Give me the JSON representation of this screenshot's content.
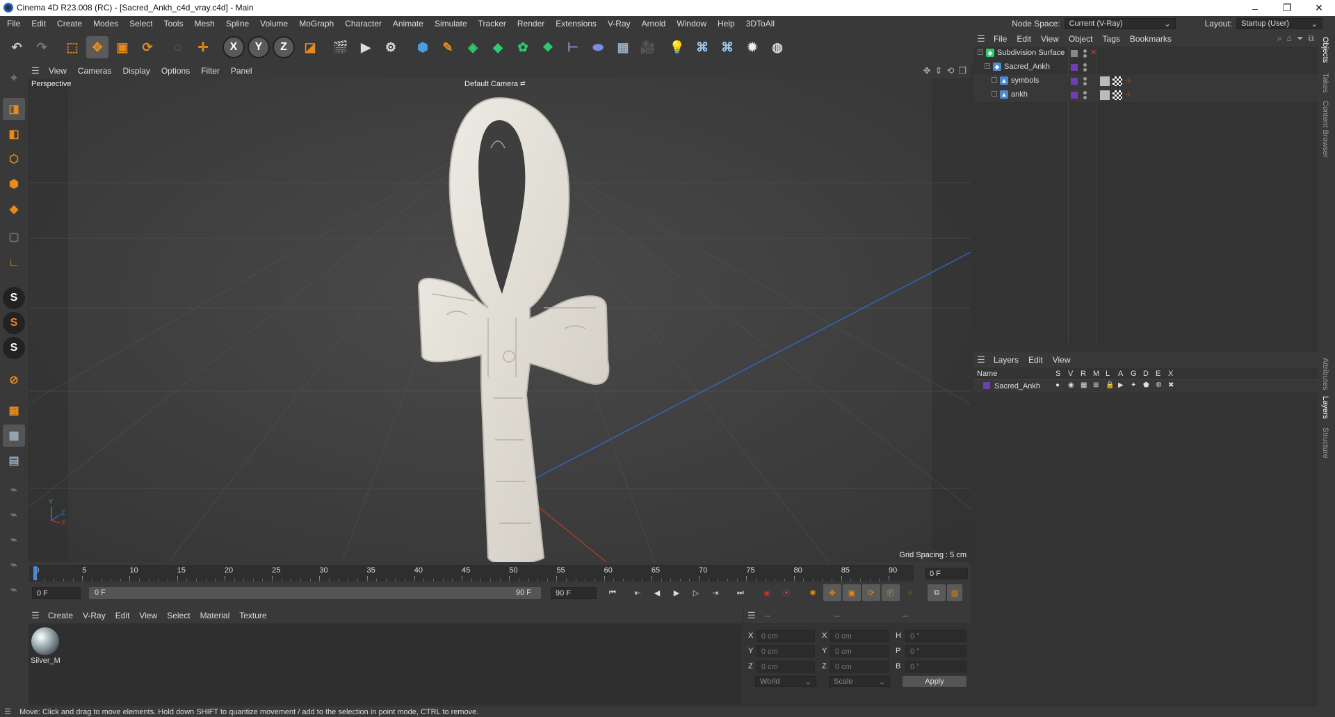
{
  "window": {
    "title": "Cinema 4D R23.008 (RC) - [Sacred_Ankh_c4d_vray.c4d] - Main",
    "minimize": "–",
    "maximize": "❐",
    "close": "✕"
  },
  "menu": {
    "items": [
      "File",
      "Edit",
      "Create",
      "Modes",
      "Select",
      "Tools",
      "Mesh",
      "Spline",
      "Volume",
      "MoGraph",
      "Character",
      "Animate",
      "Simulate",
      "Tracker",
      "Render",
      "Extensions",
      "V-Ray",
      "Arnold",
      "Window",
      "Help",
      "3DToAll"
    ],
    "node_space_label": "Node Space:",
    "node_space_value": "Current (V-Ray)",
    "layout_label": "Layout:",
    "layout_value": "Startup (User)"
  },
  "toolbar": {
    "axis_x": "X",
    "axis_y": "Y",
    "axis_z": "Z"
  },
  "viewport": {
    "menu": [
      "View",
      "Cameras",
      "Display",
      "Options",
      "Filter",
      "Panel"
    ],
    "name": "Perspective",
    "camera": "Default Camera",
    "grid_spacing": "Grid Spacing : 5 cm",
    "axis_y": "Y",
    "axis_z": "Z",
    "axis_x": "X"
  },
  "timeline": {
    "ticks": [
      "0",
      "5",
      "10",
      "15",
      "20",
      "25",
      "30",
      "35",
      "40",
      "45",
      "50",
      "55",
      "60",
      "65",
      "70",
      "75",
      "80",
      "85",
      "90"
    ],
    "current_frame": "0 F",
    "start": "0 F",
    "range_start": "0 F",
    "range_end": "90 F",
    "end": "90 F"
  },
  "materials": {
    "menu": [
      "Create",
      "V-Ray",
      "Edit",
      "View",
      "Select",
      "Material",
      "Texture"
    ],
    "items": [
      {
        "name": "Silver_M"
      }
    ]
  },
  "coords": {
    "headers": [
      "--",
      "--",
      "--"
    ],
    "rows": [
      {
        "a": "X",
        "av": "0 cm",
        "b": "X",
        "bv": "0 cm",
        "c": "H",
        "cv": "0 °"
      },
      {
        "a": "Y",
        "av": "0 cm",
        "b": "Y",
        "bv": "0 cm",
        "c": "P",
        "cv": "0 °"
      },
      {
        "a": "Z",
        "av": "0 cm",
        "b": "Z",
        "bv": "0 cm",
        "c": "B",
        "cv": "0 °"
      }
    ],
    "world": "World",
    "scale": "Scale",
    "apply": "Apply"
  },
  "objects": {
    "menu": [
      "File",
      "Edit",
      "View",
      "Object",
      "Tags",
      "Bookmarks"
    ],
    "tree": [
      {
        "name": "Subdivision Surface",
        "level": 0
      },
      {
        "name": "Sacred_Ankh",
        "level": 1
      },
      {
        "name": "symbols",
        "level": 2
      },
      {
        "name": "ankh",
        "level": 2
      }
    ]
  },
  "layers": {
    "menu": [
      "Layers",
      "Edit",
      "View"
    ],
    "col_name": "Name",
    "cols": [
      "S",
      "V",
      "R",
      "M",
      "L",
      "A",
      "G",
      "D",
      "E",
      "X"
    ],
    "rows": [
      {
        "name": "Sacred_Ankh"
      }
    ]
  },
  "sidetabs": [
    "Objects",
    "Takes",
    "Content Browser",
    "Attributes",
    "Layers",
    "Structure"
  ],
  "status": "Move: Click and drag to move elements. Hold down SHIFT to quantize movement / add to the selection in point mode, CTRL to remove.",
  "colors": {
    "accent": "#4a8ad0",
    "layer": "#6f3fb0",
    "orange": "#e88a1a",
    "grid": "#4a4a4a",
    "xaxis": "#c0392b",
    "yaxis": "#27ae60",
    "zaxis": "#2e6fd6"
  }
}
